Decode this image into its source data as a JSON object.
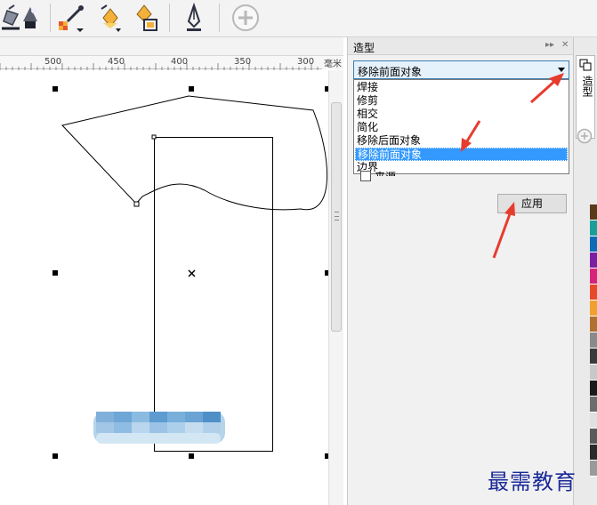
{
  "toolbar": {
    "tools": [
      {
        "icon": "fill-bucket-icon"
      },
      {
        "icon": "smart-fill-icon"
      },
      {
        "icon": "eyedropper-icon"
      },
      {
        "icon": "attributes-eyedropper-icon"
      },
      {
        "icon": "interactive-fill-icon"
      },
      {
        "icon": "pen-tool-icon"
      },
      {
        "icon": "add-tool-icon"
      }
    ]
  },
  "ruler": {
    "labels": [
      "500",
      "450",
      "400",
      "350",
      "300"
    ],
    "unit": "毫米"
  },
  "docker": {
    "title": "造型",
    "select_value": "移除前面对象",
    "options": [
      "焊接",
      "修剪",
      "相交",
      "简化",
      "移除后面对象",
      "移除前面对象",
      "边界"
    ],
    "selected_option": "移除前面对象",
    "checkbox_label": "来源",
    "apply_label": "应用"
  },
  "side_tab": {
    "label": "造型"
  },
  "palette": {
    "colors": [
      "#5b3a1a",
      "#1a9e9a",
      "#0c6bb5",
      "#7b1fa2",
      "#d6247a",
      "#e54b2a",
      "#f0a030",
      "#b07030",
      "#8a8a8a",
      "#3a3a3a",
      "#c8c8c8",
      "#1a1a1a",
      "#6d6d6d",
      "#e0e0e0",
      "#5a5a5a",
      "#2a2a2a",
      "#9a9a9a"
    ]
  },
  "watermark": {
    "text": "最需教育"
  },
  "colors": {
    "selection_blue": "#3399ff",
    "arrow_red": "#e63c2e",
    "select_border": "#3c7fb1"
  }
}
